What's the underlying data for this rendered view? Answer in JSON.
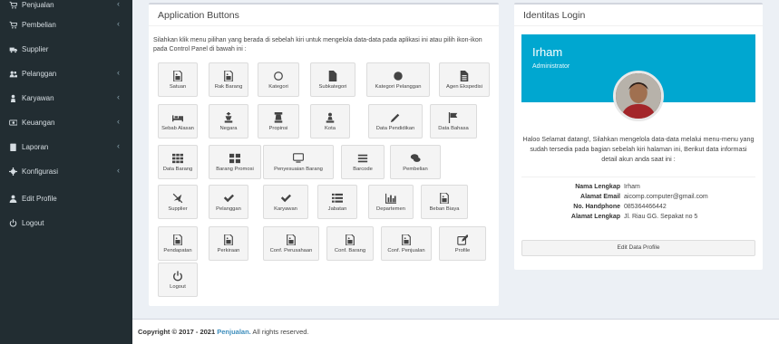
{
  "sidebar": {
    "items": [
      {
        "label": "Penjualan",
        "icon": "cart-icon",
        "caret": "‹"
      },
      {
        "label": "Pembelian",
        "icon": "cart-icon",
        "caret": "‹"
      },
      {
        "label": "Supplier",
        "icon": "truck-icon",
        "caret": ""
      },
      {
        "label": "Pelanggan",
        "icon": "users-icon",
        "caret": "‹"
      },
      {
        "label": "Karyawan",
        "icon": "user-tie-icon",
        "caret": "‹"
      },
      {
        "label": "Keuangan",
        "icon": "money-icon",
        "caret": "‹"
      },
      {
        "label": "Laporan",
        "icon": "book-icon",
        "caret": "‹"
      },
      {
        "label": "Konfigurasi",
        "icon": "gear-icon",
        "caret": "‹"
      },
      {
        "label": "Edit Profile",
        "icon": "user-icon",
        "caret": ""
      },
      {
        "label": "Logout",
        "icon": "power-icon",
        "caret": ""
      }
    ]
  },
  "app_buttons": {
    "title": "Application Buttons",
    "intro": "Silahkan klik menu pilihan yang berada di sebelah kiri untuk mengelola data-data pada aplikasi ini atau pilih ikon-ikon pada Control Panel di bawah ini :",
    "tiles": [
      {
        "label": "Satuan",
        "icon": "image-file-icon"
      },
      {
        "label": "Rak Barang",
        "icon": "image-file-icon"
      },
      {
        "label": "Kategori",
        "icon": "circle-outline-icon"
      },
      {
        "label": "Subkategori",
        "icon": "file-icon"
      },
      {
        "label": "Kategori Pelanggan",
        "icon": "circle-icon"
      },
      {
        "label": "Agen Ekspedisi",
        "icon": "file-text-icon"
      },
      {
        "label": "Sebab Alasan",
        "icon": "bed-icon"
      },
      {
        "label": "Negara",
        "icon": "chess-king-icon"
      },
      {
        "label": "Propinsi",
        "icon": "chess-rook-icon"
      },
      {
        "label": "Kota",
        "icon": "chess-pawn-icon"
      },
      {
        "label": "Data Pendidikan",
        "icon": "pencil-icon"
      },
      {
        "label": "Data Bahasa",
        "icon": "flag-icon"
      },
      {
        "label": "Data Barang",
        "icon": "grid-icon"
      },
      {
        "label": "Barang Promosi",
        "icon": "grid-large-icon"
      },
      {
        "label": "Penyesuaian Barang",
        "icon": "monitor-icon"
      },
      {
        "label": "Barcode",
        "icon": "bars-icon"
      },
      {
        "label": "Pembelian",
        "icon": "comments-icon"
      },
      {
        "label": "Supplier",
        "icon": "plane-slash-icon"
      },
      {
        "label": "Pelanggan",
        "icon": "check-icon"
      },
      {
        "label": "Karyawan",
        "icon": "check-icon"
      },
      {
        "label": "Jabatan",
        "icon": "list-icon"
      },
      {
        "label": "Departemen",
        "icon": "bar-chart-icon"
      },
      {
        "label": "Beban Biaya",
        "icon": "image-file-icon"
      },
      {
        "label": "Pendapatan",
        "icon": "image-file-icon"
      },
      {
        "label": "Perkiraan",
        "icon": "image-file-icon"
      },
      {
        "label": "Conf. Perusahaan",
        "icon": "image-file-icon"
      },
      {
        "label": "Conf. Barang",
        "icon": "image-file-icon"
      },
      {
        "label": "Conf. Penjualan",
        "icon": "image-file-icon"
      },
      {
        "label": "Profile",
        "icon": "edit-icon"
      },
      {
        "label": "Logout",
        "icon": "power-icon"
      }
    ]
  },
  "identity": {
    "title": "Identitas Login",
    "name": "Irham",
    "role": "Administrator",
    "greeting": "Haloo Selamat datang!, Silahkan mengelola data-data melalui menu-menu yang sudah tersedia pada bagian sebelah kiri halaman ini, Berikut data informasi detail akun anda saat ini :",
    "details": [
      {
        "label": "Nama Lengkap",
        "value": "Irham"
      },
      {
        "label": "Alamat Email",
        "value": "aicomp.computer@gmail.com"
      },
      {
        "label": "No. Handphone",
        "value": "085364466442"
      },
      {
        "label": "Alamat Lengkap",
        "value": "Jl. Riau GG. Sepakat no 5"
      }
    ],
    "edit_button": "Edit Data Profile"
  },
  "footer": {
    "prefix": "Copyright © 2017 - 2021",
    "link": "Penjualan.",
    "suffix": "All rights reserved."
  },
  "colors": {
    "sidebar_bg": "#222d32",
    "profile_accent": "#00a7d0",
    "link": "#3c8dbc",
    "page_bg": "#ecf0f5"
  }
}
